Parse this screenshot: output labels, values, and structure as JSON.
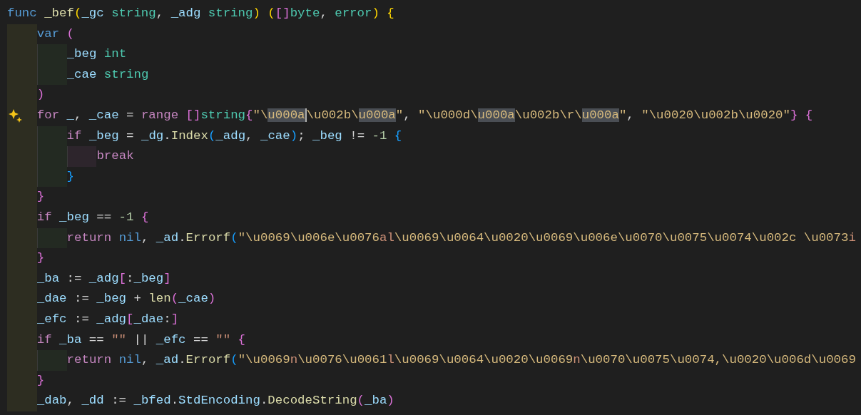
{
  "editor": {
    "lines": [
      {
        "tokens": [
          {
            "text": "func ",
            "kind": "keyword"
          },
          {
            "text": "_bef",
            "kind": "function"
          },
          {
            "text": "(",
            "kind": "bracket1"
          },
          {
            "text": "_gc ",
            "kind": "variable"
          },
          {
            "text": "string",
            "kind": "type"
          },
          {
            "text": ", ",
            "kind": "punct"
          },
          {
            "text": "_adg ",
            "kind": "variable"
          },
          {
            "text": "string",
            "kind": "type"
          },
          {
            "text": ") (",
            "kind": "bracket1"
          },
          {
            "text": "[]",
            "kind": "bracket2"
          },
          {
            "text": "byte",
            "kind": "type"
          },
          {
            "text": ", ",
            "kind": "punct"
          },
          {
            "text": "error",
            "kind": "type"
          },
          {
            "text": ") {",
            "kind": "bracket1"
          }
        ],
        "children": [
          {
            "tokens": [
              {
                "text": "var ",
                "kind": "keyword"
              },
              {
                "text": "(",
                "kind": "bracket2"
              }
            ],
            "children": [
              {
                "tokens": [
                  {
                    "text": "_beg ",
                    "kind": "variable"
                  },
                  {
                    "text": "int",
                    "kind": "type"
                  }
                ]
              },
              {
                "tokens": [
                  {
                    "text": "_cae ",
                    "kind": "variable"
                  },
                  {
                    "text": "string",
                    "kind": "type"
                  }
                ]
              }
            ]
          },
          {
            "tokens": [
              {
                "text": ")",
                "kind": "bracket2"
              }
            ]
          },
          {
            "gutter_action": true,
            "tokens": [
              {
                "text": "for ",
                "kind": "control"
              },
              {
                "text": "_",
                "kind": "variable"
              },
              {
                "text": ", ",
                "kind": "punct"
              },
              {
                "text": "_cae",
                "kind": "variable"
              },
              {
                "text": " = ",
                "kind": "punct"
              },
              {
                "text": "range ",
                "kind": "control"
              },
              {
                "text": "[]",
                "kind": "bracket2"
              },
              {
                "text": "string",
                "kind": "type"
              },
              {
                "text": "{",
                "kind": "bracket2"
              },
              {
                "text": "\"\\",
                "kind": "escape"
              },
              {
                "text": "u000a",
                "kind": "escape",
                "highlighted": true,
                "cursor_after": true
              },
              {
                "text": "\\u002b\\",
                "kind": "escape"
              },
              {
                "text": "u000a",
                "kind": "escape",
                "highlighted": true
              },
              {
                "text": "\"",
                "kind": "escape"
              },
              {
                "text": ", ",
                "kind": "punct"
              },
              {
                "text": "\"\\u000d\\",
                "kind": "escape"
              },
              {
                "text": "u000a",
                "kind": "escape",
                "highlighted": true
              },
              {
                "text": "\\u002b\\r\\",
                "kind": "escape"
              },
              {
                "text": "u000a",
                "kind": "escape",
                "highlighted": true
              },
              {
                "text": "\"",
                "kind": "escape"
              },
              {
                "text": ", ",
                "kind": "punct"
              },
              {
                "text": "\"\\u0020\\u002b\\u0020\"",
                "kind": "escape"
              },
              {
                "text": "} {",
                "kind": "bracket2"
              }
            ],
            "children": [
              {
                "tokens": [
                  {
                    "text": "if ",
                    "kind": "control"
                  },
                  {
                    "text": "_beg",
                    "kind": "variable"
                  },
                  {
                    "text": " = ",
                    "kind": "punct"
                  },
                  {
                    "text": "_dg",
                    "kind": "variable"
                  },
                  {
                    "text": ".",
                    "kind": "punct"
                  },
                  {
                    "text": "Index",
                    "kind": "function"
                  },
                  {
                    "text": "(",
                    "kind": "bracket3"
                  },
                  {
                    "text": "_adg",
                    "kind": "variable"
                  },
                  {
                    "text": ", ",
                    "kind": "punct"
                  },
                  {
                    "text": "_cae",
                    "kind": "variable"
                  },
                  {
                    "text": ")",
                    "kind": "bracket3"
                  },
                  {
                    "text": "; ",
                    "kind": "punct"
                  },
                  {
                    "text": "_beg",
                    "kind": "variable"
                  },
                  {
                    "text": " != ",
                    "kind": "punct"
                  },
                  {
                    "text": "-1 ",
                    "kind": "number"
                  },
                  {
                    "text": "{",
                    "kind": "bracket3"
                  }
                ],
                "children": [
                  {
                    "tokens": [
                      {
                        "text": "break",
                        "kind": "control"
                      }
                    ]
                  }
                ]
              },
              {
                "tokens": [
                  {
                    "text": "}",
                    "kind": "bracket3"
                  }
                ]
              }
            ]
          },
          {
            "tokens": [
              {
                "text": "}",
                "kind": "bracket2"
              }
            ]
          },
          {
            "tokens": [
              {
                "text": "if ",
                "kind": "control"
              },
              {
                "text": "_beg",
                "kind": "variable"
              },
              {
                "text": " == ",
                "kind": "punct"
              },
              {
                "text": "-1 ",
                "kind": "number"
              },
              {
                "text": "{",
                "kind": "bracket2"
              }
            ],
            "children": [
              {
                "tokens": [
                  {
                    "text": "return ",
                    "kind": "control"
                  },
                  {
                    "text": "nil",
                    "kind": "keyword"
                  },
                  {
                    "text": ", ",
                    "kind": "punct"
                  },
                  {
                    "text": "_ad",
                    "kind": "variable"
                  },
                  {
                    "text": ".",
                    "kind": "punct"
                  },
                  {
                    "text": "Errorf",
                    "kind": "function"
                  },
                  {
                    "text": "(",
                    "kind": "bracket3"
                  },
                  {
                    "text": "\"\\u0069\\u006e\\u0076",
                    "kind": "escape"
                  },
                  {
                    "text": "al",
                    "kind": "string"
                  },
                  {
                    "text": "\\u0069\\u0064\\u0020\\u0069\\u006e\\u0070\\u0075\\u0074\\u002c \\u0073",
                    "kind": "escape"
                  },
                  {
                    "text": "i",
                    "kind": "string"
                  }
                ]
              }
            ]
          },
          {
            "tokens": [
              {
                "text": "}",
                "kind": "bracket2"
              }
            ]
          },
          {
            "tokens": [
              {
                "text": "_ba",
                "kind": "variable"
              },
              {
                "text": " := ",
                "kind": "punct"
              },
              {
                "text": "_adg",
                "kind": "variable"
              },
              {
                "text": "[",
                "kind": "bracket2"
              },
              {
                "text": ":",
                "kind": "punct"
              },
              {
                "text": "_beg",
                "kind": "variable"
              },
              {
                "text": "]",
                "kind": "bracket2"
              }
            ]
          },
          {
            "tokens": [
              {
                "text": "_dae",
                "kind": "variable"
              },
              {
                "text": " := ",
                "kind": "punct"
              },
              {
                "text": "_beg",
                "kind": "variable"
              },
              {
                "text": " + ",
                "kind": "punct"
              },
              {
                "text": "len",
                "kind": "function"
              },
              {
                "text": "(",
                "kind": "bracket2"
              },
              {
                "text": "_cae",
                "kind": "variable"
              },
              {
                "text": ")",
                "kind": "bracket2"
              }
            ]
          },
          {
            "tokens": [
              {
                "text": "_efc",
                "kind": "variable"
              },
              {
                "text": " := ",
                "kind": "punct"
              },
              {
                "text": "_adg",
                "kind": "variable"
              },
              {
                "text": "[",
                "kind": "bracket2"
              },
              {
                "text": "_dae",
                "kind": "variable"
              },
              {
                "text": ":",
                "kind": "punct"
              },
              {
                "text": "]",
                "kind": "bracket2"
              }
            ]
          },
          {
            "tokens": [
              {
                "text": "if ",
                "kind": "control"
              },
              {
                "text": "_ba",
                "kind": "variable"
              },
              {
                "text": " == ",
                "kind": "punct"
              },
              {
                "text": "\"\"",
                "kind": "string"
              },
              {
                "text": " || ",
                "kind": "punct"
              },
              {
                "text": "_efc",
                "kind": "variable"
              },
              {
                "text": " == ",
                "kind": "punct"
              },
              {
                "text": "\"\" ",
                "kind": "string"
              },
              {
                "text": "{",
                "kind": "bracket2"
              }
            ],
            "children": [
              {
                "tokens": [
                  {
                    "text": "return ",
                    "kind": "control"
                  },
                  {
                    "text": "nil",
                    "kind": "keyword"
                  },
                  {
                    "text": ", ",
                    "kind": "punct"
                  },
                  {
                    "text": "_ad",
                    "kind": "variable"
                  },
                  {
                    "text": ".",
                    "kind": "punct"
                  },
                  {
                    "text": "Errorf",
                    "kind": "function"
                  },
                  {
                    "text": "(",
                    "kind": "bracket3"
                  },
                  {
                    "text": "\"\\u0069",
                    "kind": "escape"
                  },
                  {
                    "text": "n",
                    "kind": "string"
                  },
                  {
                    "text": "\\u0076\\u0061",
                    "kind": "escape"
                  },
                  {
                    "text": "l",
                    "kind": "string"
                  },
                  {
                    "text": "\\u0069\\u0064\\u0020\\u0069",
                    "kind": "escape"
                  },
                  {
                    "text": "n",
                    "kind": "string"
                  },
                  {
                    "text": "\\u0070\\u0075\\u0074,\\u0020\\u006d\\u0069",
                    "kind": "escape"
                  }
                ]
              }
            ]
          },
          {
            "tokens": [
              {
                "text": "}",
                "kind": "bracket2"
              }
            ]
          },
          {
            "tokens": [
              {
                "text": "_dab",
                "kind": "variable"
              },
              {
                "text": ", ",
                "kind": "punct"
              },
              {
                "text": "_dd",
                "kind": "variable"
              },
              {
                "text": " := ",
                "kind": "punct"
              },
              {
                "text": "_bfed",
                "kind": "variable"
              },
              {
                "text": ".",
                "kind": "punct"
              },
              {
                "text": "StdEncoding",
                "kind": "variable"
              },
              {
                "text": ".",
                "kind": "punct"
              },
              {
                "text": "DecodeString",
                "kind": "function"
              },
              {
                "text": "(",
                "kind": "bracket2"
              },
              {
                "text": "_ba",
                "kind": "variable"
              },
              {
                "text": ")",
                "kind": "bracket2"
              }
            ]
          }
        ]
      }
    ]
  }
}
